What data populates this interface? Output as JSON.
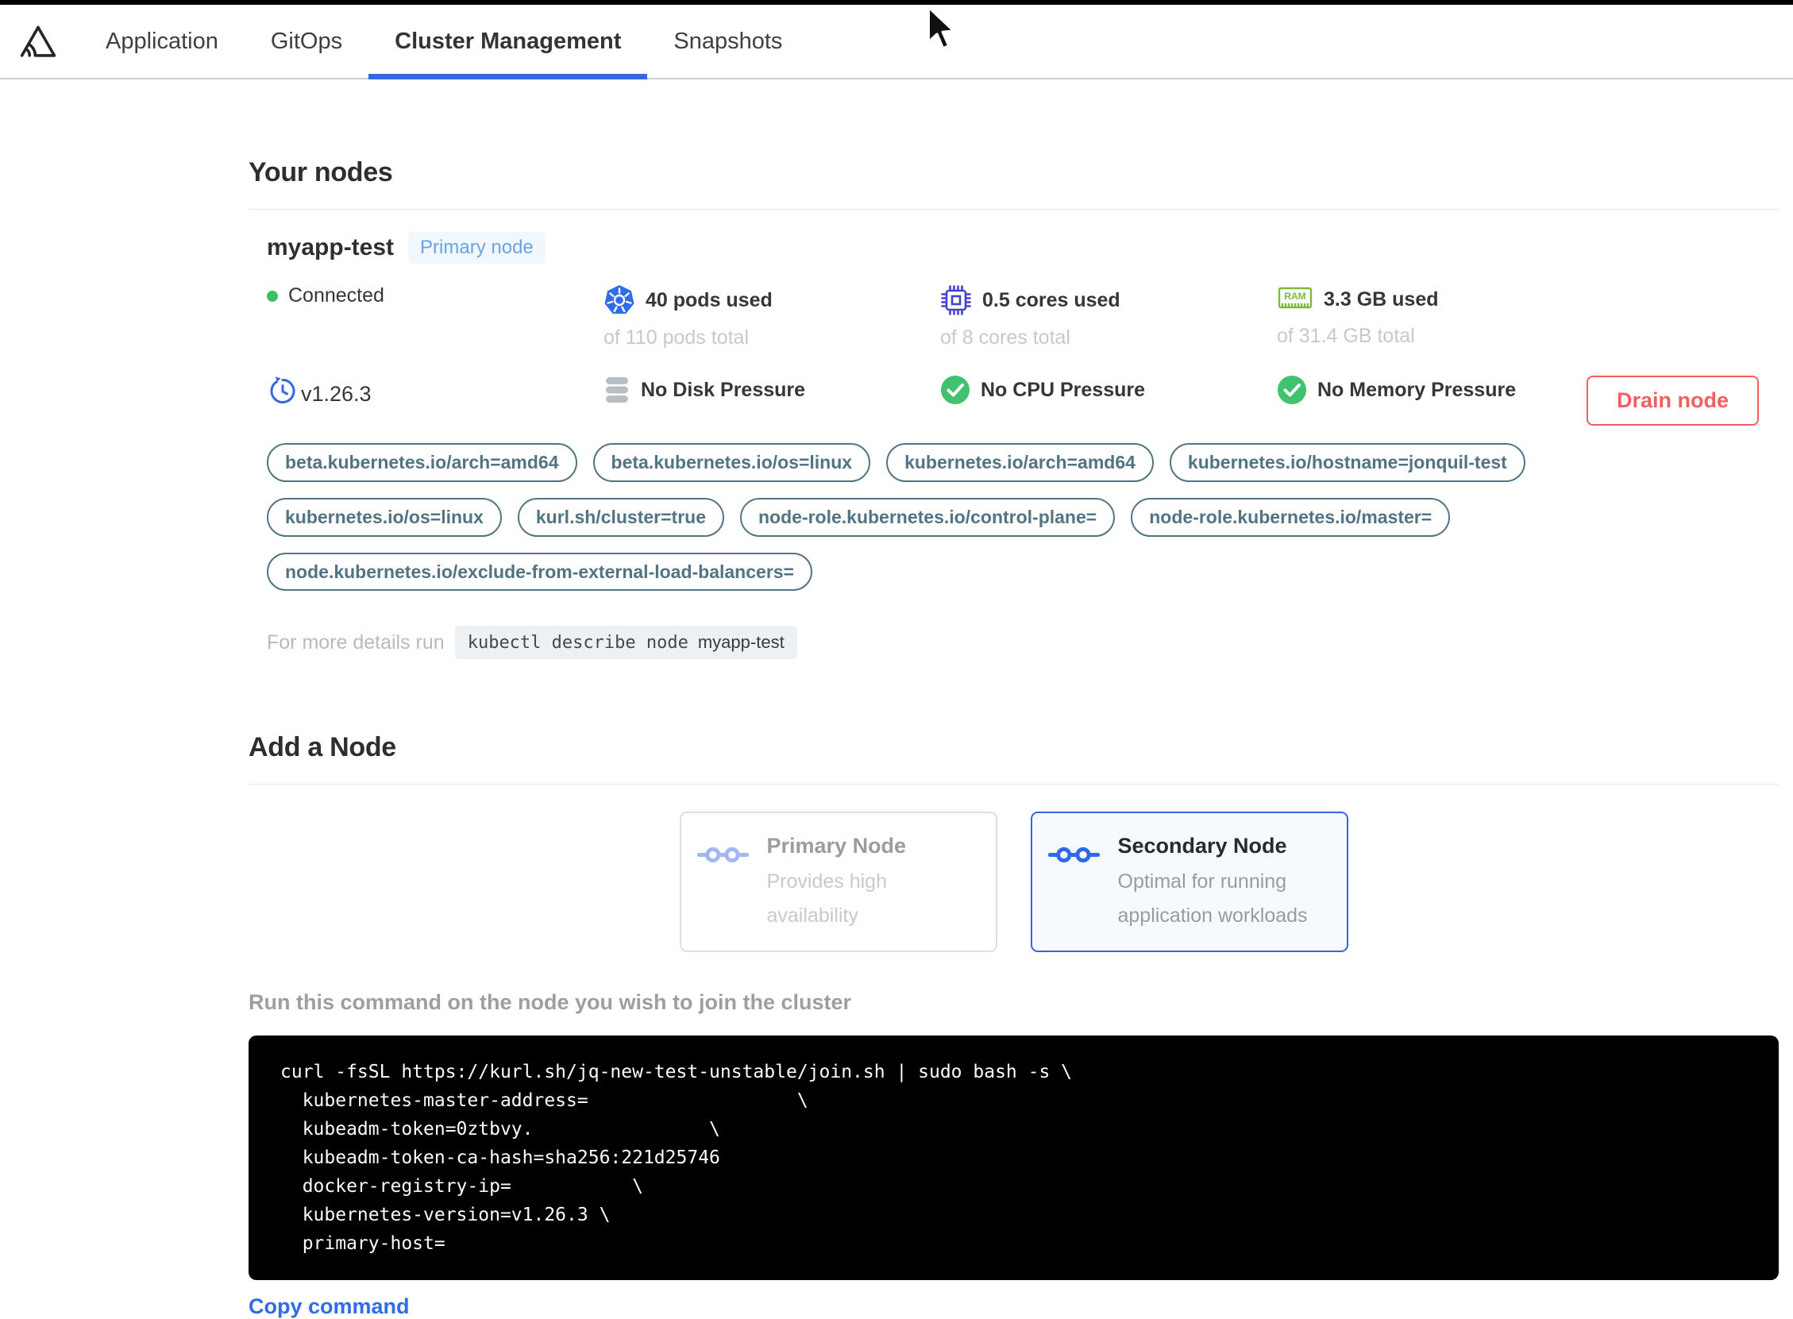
{
  "nav": {
    "logo_icon": "sentry-style-triangle-logo",
    "tabs": [
      {
        "label": "Application"
      },
      {
        "label": "GitOps"
      },
      {
        "label": "Cluster Management"
      },
      {
        "label": "Snapshots"
      }
    ],
    "active_tab": "Cluster Management"
  },
  "your_nodes": {
    "title": "Your nodes",
    "node": {
      "name": "myapp-test",
      "badge": "Primary node",
      "status": "Connected",
      "version": "v1.26.3",
      "stats": {
        "pods": {
          "used": "40 pods used",
          "total": "of 110 pods total"
        },
        "cpu": {
          "used": "0.5 cores used",
          "total": "of 8 cores total"
        },
        "memory": {
          "used": "3.3 GB used",
          "total": "of 31.4 GB total"
        }
      },
      "conditions": {
        "disk": "No Disk Pressure",
        "cpu": "No CPU Pressure",
        "memory": "No Memory Pressure"
      },
      "labels": [
        "beta.kubernetes.io/arch=amd64",
        "beta.kubernetes.io/os=linux",
        "kubernetes.io/arch=amd64",
        "kubernetes.io/hostname=jonquil-test",
        "kubernetes.io/os=linux",
        "kurl.sh/cluster=true",
        "node-role.kubernetes.io/control-plane=",
        "node-role.kubernetes.io/master=",
        "node.kubernetes.io/exclude-from-external-load-balancers="
      ],
      "details_prefix": "For more details run",
      "details_command": "kubectl describe node",
      "details_command_arg": "myapp-test",
      "drain_button": "Drain node"
    }
  },
  "add_node": {
    "title": "Add a Node",
    "options": [
      {
        "title": "Primary Node",
        "description": "Provides high availability",
        "selected": false
      },
      {
        "title": "Secondary Node",
        "description": "Optimal for running application workloads",
        "selected": true
      }
    ],
    "instruction": "Run this command on the node you wish to join the cluster",
    "command_lines": [
      "curl -fsSL https://kurl.sh/jq-new-test-unstable/join.sh | sudo bash -s \\",
      "  kubernetes-master-address=                   \\",
      "  kubeadm-token=0ztbvy.                \\",
      "  kubeadm-token-ca-hash=sha256:221d25746",
      "  docker-registry-ip=           \\",
      "  kubernetes-version=v1.26.3 \\",
      "  primary-host="
    ],
    "copy_label": "Copy command"
  },
  "icons": {
    "ram_text": "RAM",
    "pods_icon": "kubernetes-icon",
    "cpu_icon": "cpu-chip-icon",
    "memory_icon": "ram-icon",
    "version_icon": "history-icon",
    "disk_icon": "database-icon",
    "ok_icon": "check-circle-icon",
    "option_icon": "linked-nodes-icon"
  },
  "colors": {
    "accent_blue": "#3567e2",
    "badge_blue": "#68a4e0",
    "success_green": "#41c26e",
    "status_dot_green": "#3fbf63",
    "danger_red": "#f25f5f",
    "pill_slate": "#527482",
    "kubernetes_blue": "#326ce5",
    "cpu_indigo": "#4540cf",
    "ram_green": "#7fba3e",
    "muted_gray": "#c5c9cc",
    "code_bg": "#000000"
  }
}
